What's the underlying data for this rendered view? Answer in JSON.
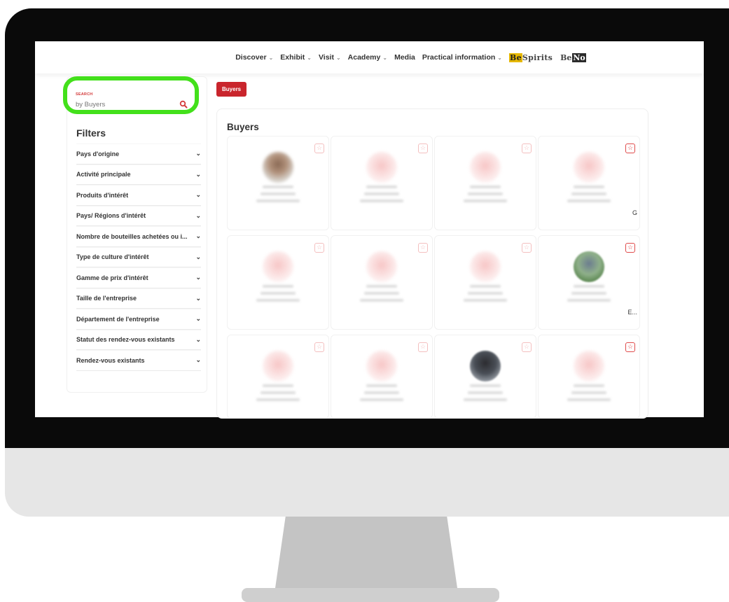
{
  "nav": {
    "items": [
      {
        "label": "Discover",
        "has_menu": true
      },
      {
        "label": "Exhibit",
        "has_menu": true
      },
      {
        "label": "Visit",
        "has_menu": true
      },
      {
        "label": "Academy",
        "has_menu": true
      },
      {
        "label": "Media",
        "has_menu": false
      },
      {
        "label": "Practical information",
        "has_menu": true
      }
    ],
    "brand1_prefix": "Be",
    "brand1_rest": "Spirits",
    "brand2_prefix": "Be",
    "brand2_rest": "No"
  },
  "search": {
    "label": "SEARCH",
    "placeholder": "by Buyers",
    "highlight_color": "#43e01b"
  },
  "filters": {
    "title": "Filters",
    "items": [
      "Pays d'origine",
      "Activité principale",
      "Produits d'intérêt",
      "Pays/ Régions d'intérêt",
      "Nombre de bouteilles achetées ou i...",
      "Type de culture d'intérêt",
      "Gamme de prix d'intérêt",
      "Taille de l'entreprise",
      "Département de l'entreprise",
      "Statut des rendez-vous existants",
      "Rendez-vous existants"
    ]
  },
  "main": {
    "badge": "Buyers",
    "title": "Buyers",
    "accent": "#c9252c",
    "card_trailing": [
      "",
      "",
      "",
      "G",
      "",
      "",
      "",
      "E...",
      "",
      "",
      "",
      ""
    ]
  }
}
